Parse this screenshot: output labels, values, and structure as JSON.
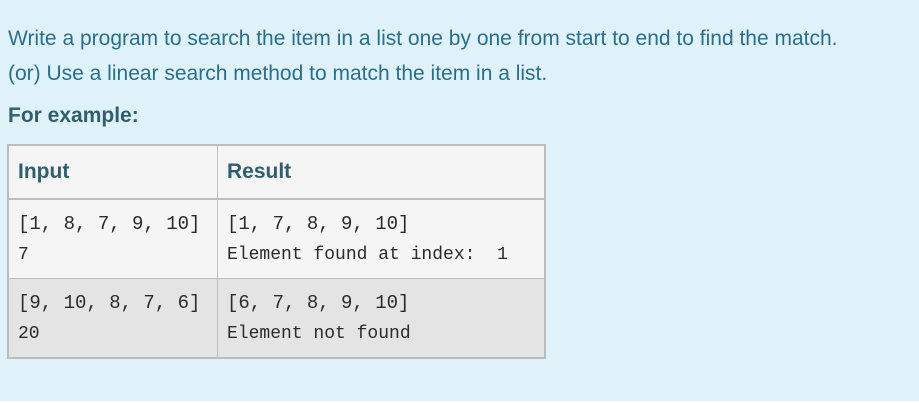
{
  "question": {
    "line1": "Write a program to search the item in a list one by one from start to end to find the match.",
    "line2": "(or) Use a linear search method to match the item in a list."
  },
  "example_heading": "For example:",
  "table": {
    "headers": {
      "input": "Input",
      "result": "Result"
    },
    "rows": [
      {
        "input_line1": "[1, 8, 7, 9, 10]",
        "input_line2": "7",
        "result_line1": "[1, 7, 8, 9, 10]",
        "result_line2": "Element found at index:  1"
      },
      {
        "input_line1": "[9, 10, 8, 7, 6]",
        "input_line2": "20",
        "result_line1": "[6, 7, 8, 9, 10]",
        "result_line2": "Element not found"
      }
    ]
  }
}
